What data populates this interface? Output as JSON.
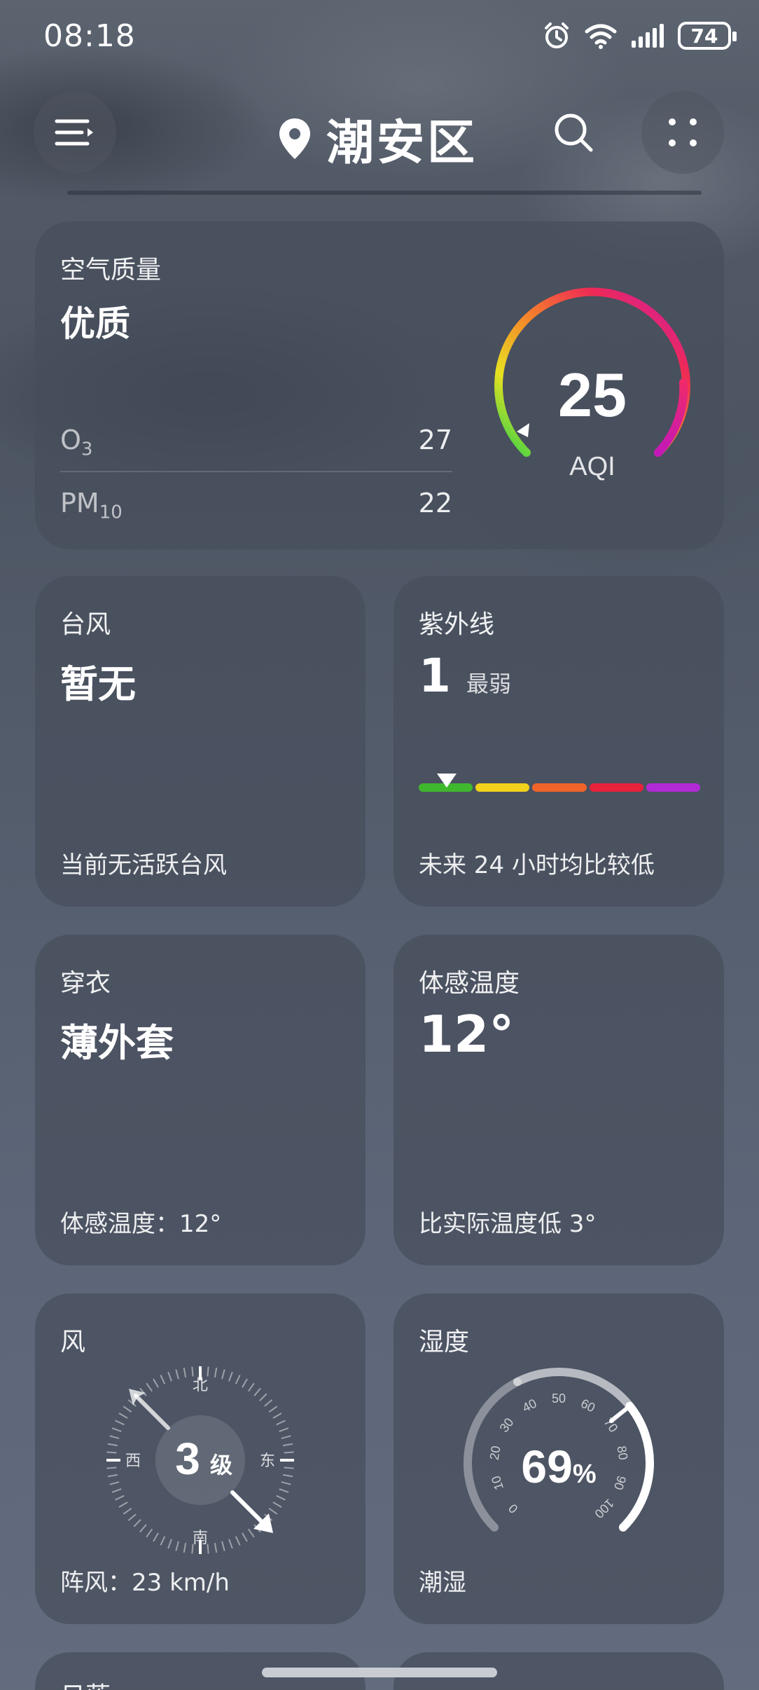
{
  "status_bar": {
    "time": "08:18",
    "battery": "74",
    "icons": [
      "alarm-icon",
      "wifi-icon",
      "signal-icon",
      "battery-icon"
    ]
  },
  "header": {
    "city": "潮安区",
    "icons": [
      "menu-icon",
      "location-pin-icon",
      "search-icon",
      "more-icon"
    ]
  },
  "air_quality": {
    "title": "空气质量",
    "level": "优质",
    "aqi_value": "25",
    "aqi_label": "AQI",
    "pollutants": [
      {
        "name": "O",
        "sub": "3",
        "value": "27"
      },
      {
        "name": "PM",
        "sub": "10",
        "value": "22"
      }
    ]
  },
  "typhoon": {
    "title": "台风",
    "value": "暂无",
    "footer": "当前无活跃台风"
  },
  "uv": {
    "title": "紫外线",
    "value": "1",
    "level": "最弱",
    "footer": "未来 24 小时均比较低",
    "scale_colors": [
      "#3fb82e",
      "#f2d21b",
      "#f0642a",
      "#e8223a",
      "#b22ad6"
    ]
  },
  "clothing": {
    "title": "穿衣",
    "value": "薄外套",
    "footer": "体感温度：12°"
  },
  "feels_like": {
    "title": "体感温度",
    "value": "12°",
    "footer": "比实际温度低 3°"
  },
  "wind": {
    "title": "风",
    "level_number": "3",
    "level_unit": "级",
    "directions": {
      "north": "北",
      "south": "南",
      "east": "东",
      "west": "西"
    },
    "footer": "阵风：23 km/h"
  },
  "humidity": {
    "title": "湿度",
    "value": "69",
    "unit": "%",
    "scale_labels": [
      "0",
      "10",
      "20",
      "30",
      "40",
      "50",
      "60",
      "70",
      "80",
      "90",
      "100"
    ],
    "footer": "潮湿",
    "level_fraction": 0.69
  },
  "next_card": {
    "title": "日落"
  }
}
